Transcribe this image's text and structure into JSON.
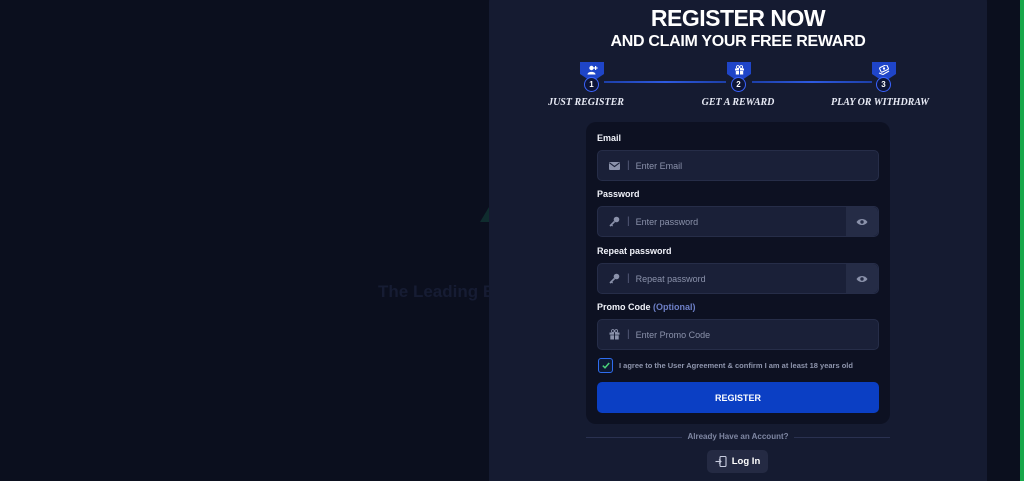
{
  "background": {
    "tagline": "The Leading Blockchain Casino",
    "accent_edge_color": "#18a84a"
  },
  "header": {
    "title": "REGISTER NOW",
    "subtitle": "AND CLAIM YOUR FREE REWARD"
  },
  "steps": [
    {
      "number": "1",
      "label": "JUST REGISTER",
      "icon": "user-plus-icon"
    },
    {
      "number": "2",
      "label": "GET A REWARD",
      "icon": "gift-icon"
    },
    {
      "number": "3",
      "label": "PLAY OR WITHDRAW",
      "icon": "coins-icon"
    }
  ],
  "form": {
    "email": {
      "label": "Email",
      "placeholder": "Enter Email",
      "icon": "envelope-icon"
    },
    "password": {
      "label": "Password",
      "placeholder": "Enter password",
      "icon": "key-icon"
    },
    "repeat_password": {
      "label": "Repeat password",
      "placeholder": "Repeat password",
      "icon": "key-icon"
    },
    "promo": {
      "label": "Promo Code",
      "optional": "(Optional)",
      "placeholder": "Enter Promo Code",
      "icon": "gift-icon"
    },
    "separator": "|",
    "agree_text": "I agree to the User Agreement & confirm I am at least 18 years old",
    "agree_checked": true,
    "register_label": "REGISTER"
  },
  "footer": {
    "already_text": "Already Have an Account?",
    "login_label": "Log In"
  },
  "colors": {
    "page_bg": "#0b0f1e",
    "modal_bg": "#151b31",
    "primary": "#0b3fc4",
    "step_accent": "#1f45c8"
  }
}
